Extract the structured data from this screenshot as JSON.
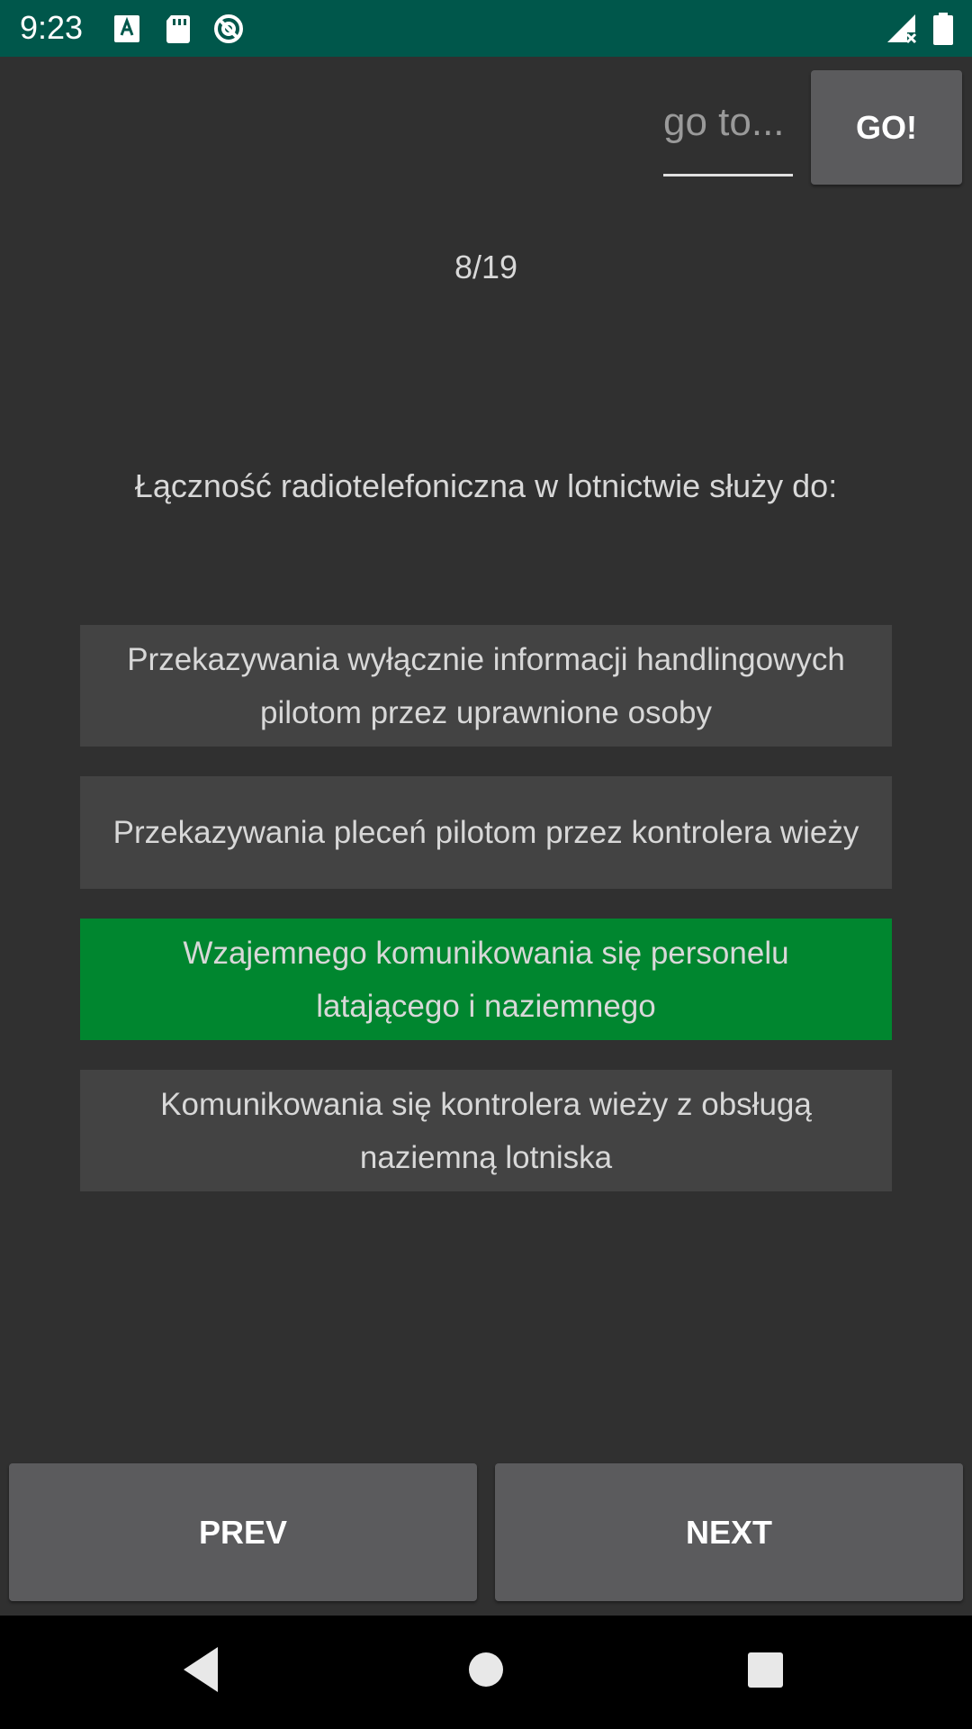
{
  "status_bar": {
    "time": "9:23",
    "icons": [
      "a-notification-icon",
      "sd-card-icon",
      "sync-icon",
      "signal-icon",
      "battery-icon"
    ],
    "background": "#00574b"
  },
  "goto": {
    "placeholder": "go to...",
    "button_label": "GO!"
  },
  "counter": "8/19",
  "question": "Łączność radiotelefoniczna w lotnictwie służy do:",
  "answers": [
    {
      "text": "Przekazywania wyłącznie informacji handlingowych pilotom przez uprawnione osoby",
      "correct": false
    },
    {
      "text": "Przekazywania pleceń pilotom przez kontrolera wieży",
      "correct": false
    },
    {
      "text": "Wzajemnego komunikowania się personelu latającego i naziemnego",
      "correct": true
    },
    {
      "text": "Komunikowania się kontrolera wieży z obsługą naziemną lotniska",
      "correct": false
    }
  ],
  "navigation": {
    "prev_label": "PREV",
    "next_label": "NEXT"
  },
  "colors": {
    "background": "#303030",
    "answer": "#434343",
    "correct_answer": "#00862f",
    "button": "#5b5b5d"
  },
  "system_nav": {
    "buttons": [
      "back-icon",
      "home-icon",
      "recents-icon"
    ]
  }
}
